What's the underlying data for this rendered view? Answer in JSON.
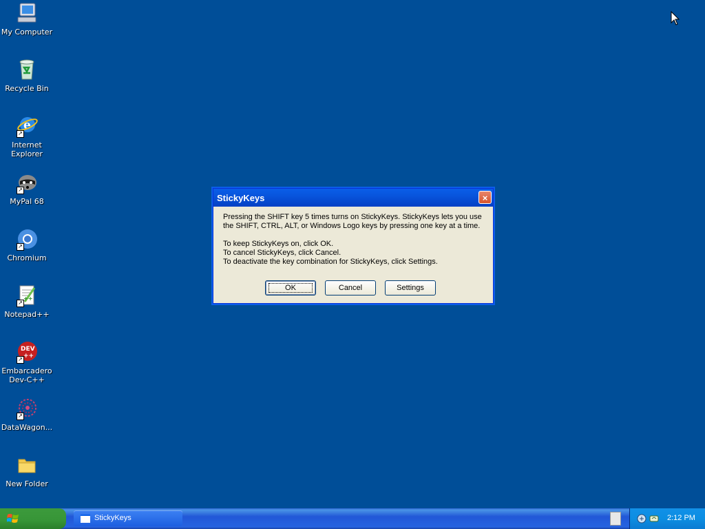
{
  "desktop": {
    "icons": [
      {
        "label": "My Computer",
        "icon": "my-computer-icon"
      },
      {
        "label": "Recycle Bin",
        "icon": "recycle-bin-icon"
      },
      {
        "label": "Internet\nExplorer",
        "icon": "internet-explorer-icon"
      },
      {
        "label": "MyPal 68",
        "icon": "mypal-icon"
      },
      {
        "label": "Chromium",
        "icon": "chromium-icon"
      },
      {
        "label": "Notepad++",
        "icon": "notepad-plus-plus-icon"
      },
      {
        "label": "Embarcadero\nDev-C++",
        "icon": "dev-cpp-icon"
      },
      {
        "label": "DataWagon...",
        "icon": "datawagon-icon"
      },
      {
        "label": "New Folder",
        "icon": "folder-icon"
      }
    ]
  },
  "dialog": {
    "title": "StickyKeys",
    "line1": "Pressing the SHIFT key 5 times turns on StickyKeys. StickyKeys lets you use",
    "line2": "the SHIFT, CTRL, ALT, or Windows Logo keys by pressing one key at a time.",
    "line3": "To keep StickyKeys on, click OK.",
    "line4": "To cancel StickyKeys, click Cancel.",
    "line5": "To deactivate the key combination for StickyKeys, click Settings.",
    "ok_label": "OK",
    "cancel_label": "Cancel",
    "settings_label": "Settings",
    "close_symbol": "×"
  },
  "taskbar": {
    "task_label": "StickyKeys",
    "clock": "2:12 PM"
  },
  "colors": {
    "desktop_bg": "#004e98",
    "titlebar": "#0a5fe8",
    "start_green": "#3c9a3c",
    "taskbar_blue": "#2157d7",
    "tray_blue": "#0c8ee2"
  }
}
